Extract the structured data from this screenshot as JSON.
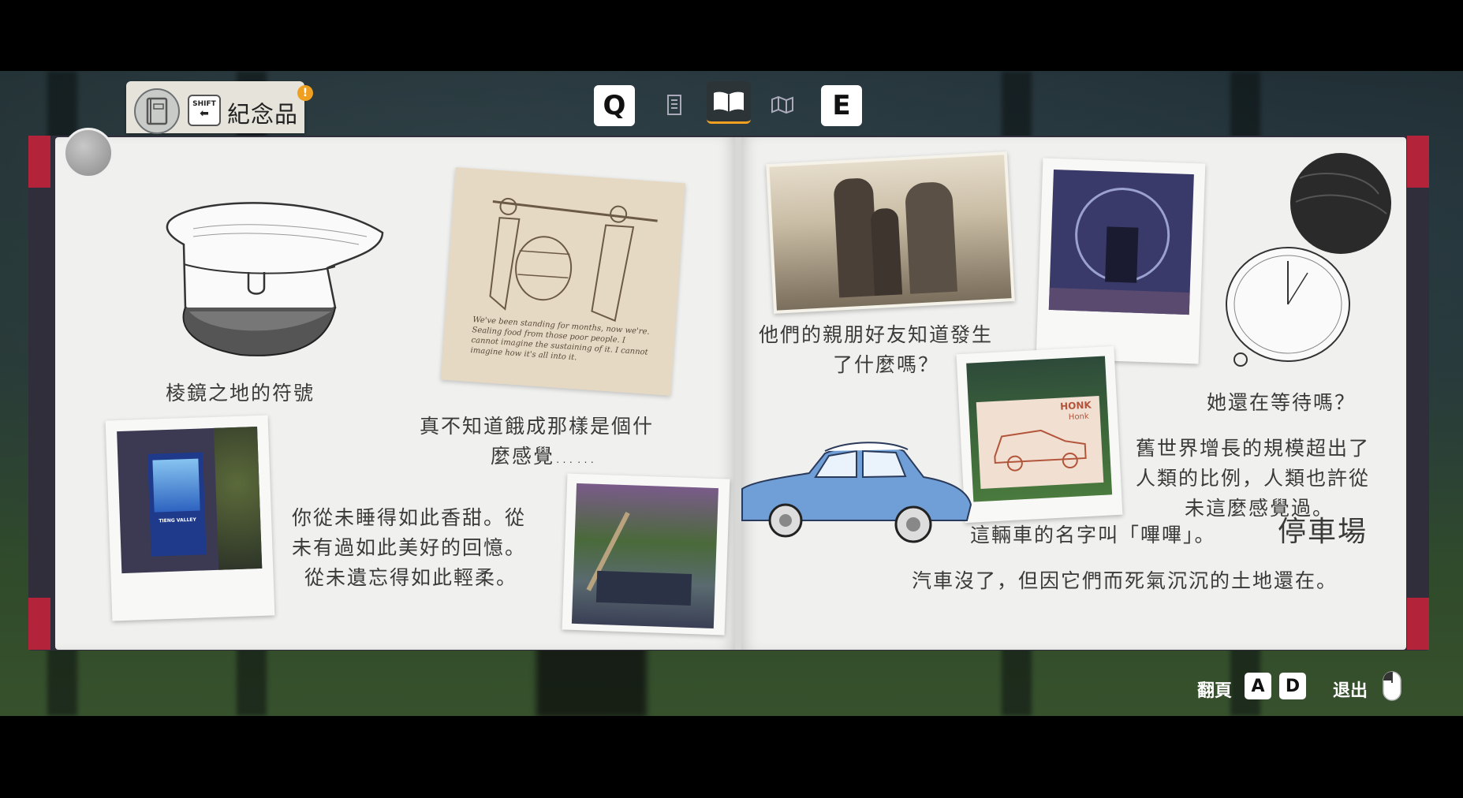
{
  "top_bar": {
    "section_label": "紀念品",
    "shift_label_top": "SHIFT",
    "shift_label_arrow": "⬅",
    "alert": "!",
    "key_prev": "Q",
    "key_next": "E",
    "icons": [
      "journal-icon",
      "list-icon",
      "open-book-icon",
      "map-icon"
    ]
  },
  "left_page": {
    "cap_caption": "棱鏡之地的符號",
    "sketch_note": "真不知道餓成那樣是個什麼感覺……",
    "sketch_note_line1": "真不知道餓成那樣是個什",
    "sketch_note_line2": "麼感覺……",
    "poster_caption_line1": "你從未睡得如此香甜。從",
    "poster_caption_line2": "未有過如此美好的回憶。",
    "poster_caption_line3": "從未遺忘得如此輕柔。",
    "poster_title": "TIENG VALLEY",
    "cursive_text": "We've been standing for months, now we're. Sealing food from those poor people. I cannot imagine the sustaining of it. I cannot imagine how it's all into it."
  },
  "right_page": {
    "family_caption_line1": "他們的親朋好友知道發生",
    "family_caption_line2": "了什麼嗎？",
    "waiting_caption": "她還在等待嗎？",
    "scale_caption_line1": "舊世界增長的規模超出了",
    "scale_caption_line2": "人類的比例，人類也許從",
    "scale_caption_line3": "未這麼感覺過。",
    "car_caption": "這輛車的名字叫「嗶嗶」。",
    "parking_title": "停車場",
    "cars_gone_caption": "汽車沒了，但因它們而死氣沉沉的土地還在。",
    "honk_text_1": "HONK",
    "honk_text_2": "Honk"
  },
  "bottom_hints": {
    "flip_label": "翻頁",
    "flip_key_a": "A",
    "flip_key_d": "D",
    "exit_label": "退出"
  },
  "colors": {
    "accent": "#f0a020",
    "page": "#f0f0ef",
    "cover_corner": "#b3243a",
    "car_blue": "#6f9fd6"
  }
}
